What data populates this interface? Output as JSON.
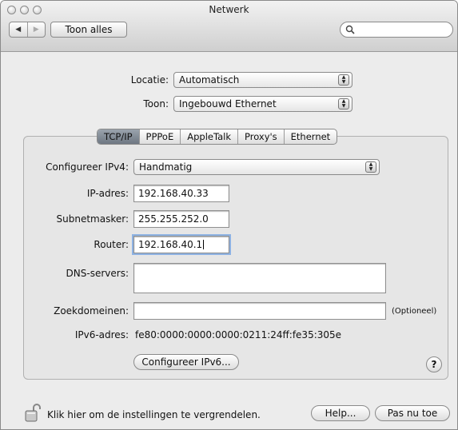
{
  "window": {
    "title": "Netwerk"
  },
  "toolbar": {
    "show_all_label": "Toon alles",
    "search_placeholder": ""
  },
  "location": {
    "label": "Locatie:",
    "value": "Automatisch"
  },
  "show": {
    "label": "Toon:",
    "value": "Ingebouwd Ethernet"
  },
  "tabs": [
    {
      "label": "TCP/IP",
      "active": true
    },
    {
      "label": "PPPoE"
    },
    {
      "label": "AppleTalk"
    },
    {
      "label": "Proxy's"
    },
    {
      "label": "Ethernet"
    }
  ],
  "form": {
    "configure_label": "Configureer IPv4:",
    "configure_value": "Handmatig",
    "ip_label": "IP-adres:",
    "ip_value": "192.168.40.33",
    "subnet_label": "Subnetmasker:",
    "subnet_value": "255.255.252.0",
    "router_label": "Router:",
    "router_value": "192.168.40.1",
    "dns_label": "DNS-servers:",
    "dns_value": "",
    "search_domains_label": "Zoekdomeinen:",
    "search_domains_value": "",
    "optional_label": "(Optioneel)",
    "ipv6_label": "IPv6-adres:",
    "ipv6_value": "fe80:0000:0000:0000:0211:24ff:fe35:305e",
    "configure_ipv6_button": "Configureer IPv6...",
    "help_symbol": "?"
  },
  "footer": {
    "lock_text": "Klik hier om de instellingen te vergrendelen.",
    "help_button": "Help...",
    "apply_button": "Pas nu toe"
  }
}
